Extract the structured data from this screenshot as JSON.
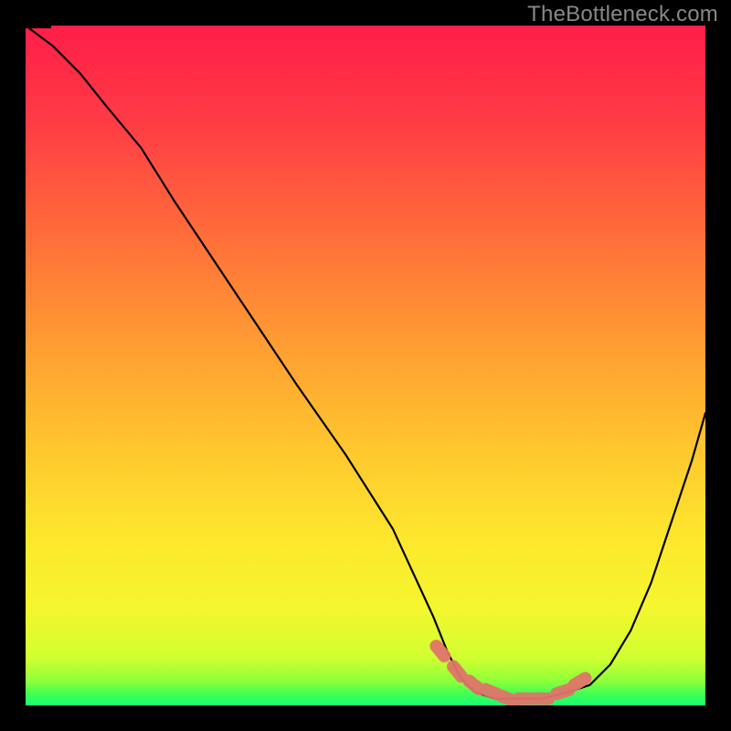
{
  "watermark": "TheBottleneck.com",
  "colors": {
    "background_gradient_stops": [
      {
        "offset": 0.0,
        "color": "#ff1e48"
      },
      {
        "offset": 0.14,
        "color": "#ff3b45"
      },
      {
        "offset": 0.3,
        "color": "#ff6b3a"
      },
      {
        "offset": 0.46,
        "color": "#ff9a33"
      },
      {
        "offset": 0.62,
        "color": "#ffc62e"
      },
      {
        "offset": 0.76,
        "color": "#fde82d"
      },
      {
        "offset": 0.86,
        "color": "#f4f62e"
      },
      {
        "offset": 0.93,
        "color": "#d0ff30"
      },
      {
        "offset": 0.965,
        "color": "#8dff3a"
      },
      {
        "offset": 0.983,
        "color": "#3fff55"
      },
      {
        "offset": 1.0,
        "color": "#18ff70"
      }
    ],
    "curve_stroke": "#000000",
    "optimal_marker": "#e0746a",
    "frame": "#000000",
    "watermark": "#888888"
  },
  "chart_data": {
    "type": "line",
    "title": "",
    "xlabel": "",
    "ylabel": "",
    "xlim": [
      0,
      100
    ],
    "ylim": [
      0,
      100
    ],
    "series": [
      {
        "name": "bottleneck_curve",
        "x": [
          0,
          4,
          8,
          12,
          17,
          22,
          28,
          34,
          40,
          47,
          54,
          60,
          62,
          64,
          66,
          69,
          72,
          76,
          80,
          83,
          86,
          89,
          92,
          95,
          98,
          100
        ],
        "y": [
          100,
          97,
          93,
          88,
          82,
          74,
          65,
          56,
          47,
          37,
          26,
          13,
          8,
          4,
          2,
          1,
          1,
          1,
          2,
          3,
          6,
          11,
          18,
          27,
          36,
          43
        ]
      }
    ],
    "optimal_range": {
      "note": "approximate flat minimum of the curve highlighted by salmon dotted marks",
      "x_points": [
        61,
        63.5,
        66,
        68.5,
        71,
        73.5,
        76,
        79,
        81.5
      ],
      "y_points": [
        8,
        5,
        3,
        2,
        1,
        1,
        1,
        2,
        3.5
      ]
    },
    "annotations": []
  }
}
